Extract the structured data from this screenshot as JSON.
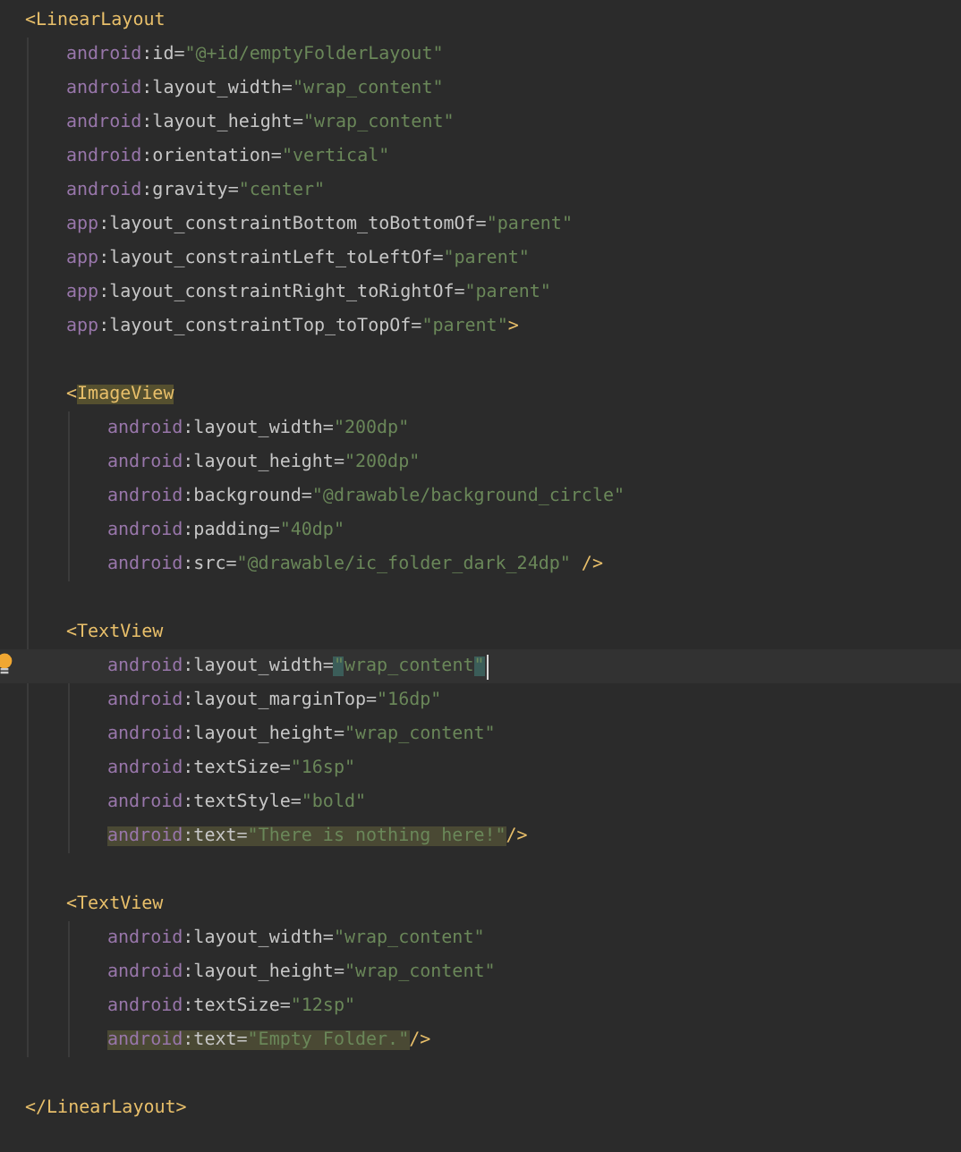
{
  "lines": [
    {
      "current": false,
      "tokens": [
        {
          "kind": "tag",
          "text": "<LinearLayout",
          "highlighted": false
        }
      ],
      "children": [
        {
          "current": false,
          "tokens": [
            {
              "kind": "ns",
              "text": "android",
              "highlighted": false
            },
            {
              "kind": "attr",
              "text": ":id=",
              "highlighted": false
            },
            {
              "kind": "value",
              "text": "\"@+id/emptyFolderLayout\"",
              "highlighted": false
            }
          ]
        },
        {
          "current": false,
          "tokens": [
            {
              "kind": "ns",
              "text": "android",
              "highlighted": false
            },
            {
              "kind": "attr",
              "text": ":layout_width=",
              "highlighted": false
            },
            {
              "kind": "value",
              "text": "\"wrap_content\"",
              "highlighted": false
            }
          ]
        },
        {
          "current": false,
          "tokens": [
            {
              "kind": "ns",
              "text": "android",
              "highlighted": false
            },
            {
              "kind": "attr",
              "text": ":layout_height=",
              "highlighted": false
            },
            {
              "kind": "value",
              "text": "\"wrap_content\"",
              "highlighted": false
            }
          ]
        },
        {
          "current": false,
          "tokens": [
            {
              "kind": "ns",
              "text": "android",
              "highlighted": false
            },
            {
              "kind": "attr",
              "text": ":orientation=",
              "highlighted": false
            },
            {
              "kind": "value",
              "text": "\"vertical\"",
              "highlighted": false
            }
          ]
        },
        {
          "current": false,
          "tokens": [
            {
              "kind": "ns",
              "text": "android",
              "highlighted": false
            },
            {
              "kind": "attr",
              "text": ":gravity=",
              "highlighted": false
            },
            {
              "kind": "value",
              "text": "\"center\"",
              "highlighted": false
            }
          ]
        },
        {
          "current": false,
          "tokens": [
            {
              "kind": "ns",
              "text": "app",
              "highlighted": false
            },
            {
              "kind": "attr",
              "text": ":layout_constraintBottom_toBottomOf=",
              "highlighted": false
            },
            {
              "kind": "value",
              "text": "\"parent\"",
              "highlighted": false
            }
          ]
        },
        {
          "current": false,
          "tokens": [
            {
              "kind": "ns",
              "text": "app",
              "highlighted": false
            },
            {
              "kind": "attr",
              "text": ":layout_constraintLeft_toLeftOf=",
              "highlighted": false
            },
            {
              "kind": "value",
              "text": "\"parent\"",
              "highlighted": false
            }
          ]
        },
        {
          "current": false,
          "tokens": [
            {
              "kind": "ns",
              "text": "app",
              "highlighted": false
            },
            {
              "kind": "attr",
              "text": ":layout_constraintRight_toRightOf=",
              "highlighted": false
            },
            {
              "kind": "value",
              "text": "\"parent\"",
              "highlighted": false
            }
          ]
        },
        {
          "current": false,
          "tokens": [
            {
              "kind": "ns",
              "text": "app",
              "highlighted": false
            },
            {
              "kind": "attr",
              "text": ":layout_constraintTop_toTopOf=",
              "highlighted": false
            },
            {
              "kind": "value",
              "text": "\"parent\"",
              "highlighted": false
            },
            {
              "kind": "tag",
              "text": ">",
              "highlighted": false
            }
          ]
        },
        {
          "current": false
        },
        {
          "current": false,
          "tokens": [
            {
              "kind": "tag",
              "text": "<",
              "highlighted": false
            },
            {
              "kind": "tag",
              "text": "ImageView",
              "highlighted": true
            }
          ],
          "children": [
            {
              "current": false,
              "tokens": [
                {
                  "kind": "ns",
                  "text": "android",
                  "highlighted": false
                },
                {
                  "kind": "attr",
                  "text": ":layout_width=",
                  "highlighted": false
                },
                {
                  "kind": "value",
                  "text": "\"200dp\"",
                  "highlighted": false
                }
              ]
            },
            {
              "current": false,
              "tokens": [
                {
                  "kind": "ns",
                  "text": "android",
                  "highlighted": false
                },
                {
                  "kind": "attr",
                  "text": ":layout_height=",
                  "highlighted": false
                },
                {
                  "kind": "value",
                  "text": "\"200dp\"",
                  "highlighted": false
                }
              ]
            },
            {
              "current": false,
              "tokens": [
                {
                  "kind": "ns",
                  "text": "android",
                  "highlighted": false
                },
                {
                  "kind": "attr",
                  "text": ":background=",
                  "highlighted": false
                },
                {
                  "kind": "value",
                  "text": "\"@drawable/background_circle\"",
                  "highlighted": false
                }
              ]
            },
            {
              "current": false,
              "tokens": [
                {
                  "kind": "ns",
                  "text": "android",
                  "highlighted": false
                },
                {
                  "kind": "attr",
                  "text": ":padding=",
                  "highlighted": false
                },
                {
                  "kind": "value",
                  "text": "\"40dp\"",
                  "highlighted": false
                }
              ]
            },
            {
              "current": false,
              "tokens": [
                {
                  "kind": "ns",
                  "text": "android",
                  "highlighted": false
                },
                {
                  "kind": "attr",
                  "text": ":src=",
                  "highlighted": false
                },
                {
                  "kind": "value",
                  "text": "\"@drawable/ic_folder_dark_24dp\"",
                  "highlighted": false
                },
                {
                  "kind": "tag",
                  "text": " />",
                  "highlighted": false
                }
              ]
            }
          ]
        },
        {
          "current": false
        },
        {
          "current": false,
          "tokens": [
            {
              "kind": "tag",
              "text": "<TextView",
              "highlighted": false
            }
          ],
          "children": [
            {
              "current": true,
              "tokens": [
                {
                  "kind": "ns",
                  "text": "android",
                  "highlighted": false
                },
                {
                  "kind": "attr",
                  "text": ":layout_width=",
                  "highlighted": false
                },
                {
                  "kind": "match",
                  "text": "\"",
                  "highlighted": false
                },
                {
                  "kind": "value",
                  "text": "wrap_content",
                  "highlighted": false
                },
                {
                  "kind": "match",
                  "text": "\"",
                  "highlighted": false
                }
              ]
            },
            {
              "current": false,
              "tokens": [
                {
                  "kind": "ns",
                  "text": "android",
                  "highlighted": false
                },
                {
                  "kind": "attr",
                  "text": ":layout_marginTop=",
                  "highlighted": false
                },
                {
                  "kind": "value",
                  "text": "\"16dp\"",
                  "highlighted": false
                }
              ]
            },
            {
              "current": false,
              "tokens": [
                {
                  "kind": "ns",
                  "text": "android",
                  "highlighted": false
                },
                {
                  "kind": "attr",
                  "text": ":layout_height=",
                  "highlighted": false
                },
                {
                  "kind": "value",
                  "text": "\"wrap_content\"",
                  "highlighted": false
                }
              ]
            },
            {
              "current": false,
              "tokens": [
                {
                  "kind": "ns",
                  "text": "android",
                  "highlighted": false
                },
                {
                  "kind": "attr",
                  "text": ":textSize=",
                  "highlighted": false
                },
                {
                  "kind": "value",
                  "text": "\"16sp\"",
                  "highlighted": false
                }
              ]
            },
            {
              "current": false,
              "tokens": [
                {
                  "kind": "ns",
                  "text": "android",
                  "highlighted": false
                },
                {
                  "kind": "attr",
                  "text": ":textStyle=",
                  "highlighted": false
                },
                {
                  "kind": "value",
                  "text": "\"bold\"",
                  "highlighted": false
                }
              ]
            },
            {
              "current": false,
              "tokens": [
                {
                  "kind": "ns",
                  "text": "android",
                  "highlighted": true
                },
                {
                  "kind": "attr",
                  "text": ":text=",
                  "highlighted": true
                },
                {
                  "kind": "value",
                  "text": "\"There is nothing here!\"",
                  "highlighted": true
                },
                {
                  "kind": "tag",
                  "text": "/>",
                  "highlighted": false
                }
              ]
            }
          ]
        },
        {
          "current": false
        },
        {
          "current": false,
          "tokens": [
            {
              "kind": "tag",
              "text": "<TextView",
              "highlighted": false
            }
          ],
          "children": [
            {
              "current": false,
              "tokens": [
                {
                  "kind": "ns",
                  "text": "android",
                  "highlighted": false
                },
                {
                  "kind": "attr",
                  "text": ":layout_width=",
                  "highlighted": false
                },
                {
                  "kind": "value",
                  "text": "\"wrap_content\"",
                  "highlighted": false
                }
              ]
            },
            {
              "current": false,
              "tokens": [
                {
                  "kind": "ns",
                  "text": "android",
                  "highlighted": false
                },
                {
                  "kind": "attr",
                  "text": ":layout_height=",
                  "highlighted": false
                },
                {
                  "kind": "value",
                  "text": "\"wrap_content\"",
                  "highlighted": false
                }
              ]
            },
            {
              "current": false,
              "tokens": [
                {
                  "kind": "ns",
                  "text": "android",
                  "highlighted": false
                },
                {
                  "kind": "attr",
                  "text": ":textSize=",
                  "highlighted": false
                },
                {
                  "kind": "value",
                  "text": "\"12sp\"",
                  "highlighted": false
                }
              ]
            },
            {
              "current": false,
              "tokens": [
                {
                  "kind": "ns",
                  "text": "android",
                  "highlighted": true
                },
                {
                  "kind": "attr",
                  "text": ":text=",
                  "highlighted": true
                },
                {
                  "kind": "value",
                  "text": "\"Empty Folder.\"",
                  "highlighted": true
                },
                {
                  "kind": "tag",
                  "text": "/>",
                  "highlighted": false
                }
              ]
            }
          ]
        }
      ]
    },
    {
      "current": false
    },
    {
      "current": false,
      "tokens": [
        {
          "kind": "tag",
          "text": "</LinearLayout>",
          "highlighted": false
        }
      ]
    }
  ]
}
